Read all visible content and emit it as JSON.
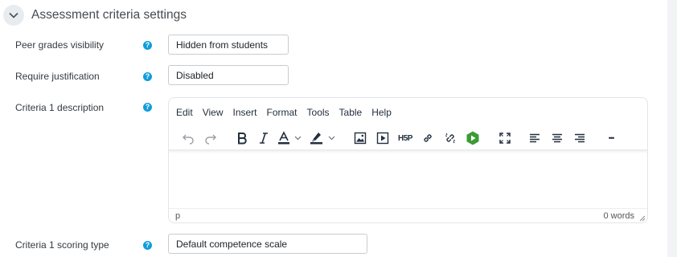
{
  "section": {
    "title": "Assessment criteria settings"
  },
  "fields": {
    "peer_visibility": {
      "label": "Peer grades visibility",
      "value": "Hidden from students"
    },
    "require_justification": {
      "label": "Require justification",
      "value": "Disabled"
    },
    "criteria1_description": {
      "label": "Criteria 1 description"
    },
    "criteria1_scoring": {
      "label": "Criteria 1 scoring type",
      "value": "Default competence scale"
    }
  },
  "help_glyph": "?",
  "editor": {
    "menu": [
      "Edit",
      "View",
      "Insert",
      "Format",
      "Tools",
      "Table",
      "Help"
    ],
    "h5p_label": "H5P",
    "more_label": "•••",
    "status_path": "p",
    "word_count": "0 words",
    "icons": [
      "undo-icon",
      "redo-icon",
      "bold-icon",
      "italic-icon",
      "text-color-icon",
      "highlight-color-icon",
      "image-icon",
      "media-icon",
      "h5p-icon",
      "link-icon",
      "unlink-icon",
      "panopto-icon",
      "fullscreen-icon",
      "align-left-icon",
      "align-center-icon",
      "align-right-icon",
      "more-icon"
    ]
  },
  "colors": {
    "help": "#0f9ddb",
    "panopto": "#3d9b35"
  }
}
